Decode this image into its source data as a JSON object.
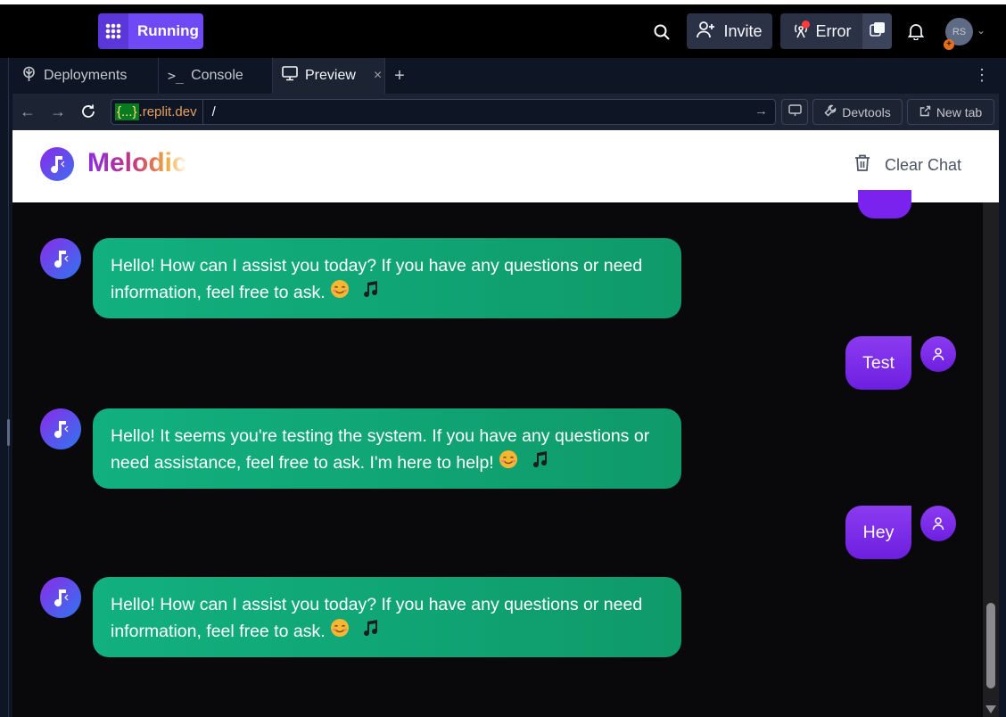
{
  "topbar": {
    "run_label": "Running",
    "invite_label": "Invite",
    "error_label": "Error",
    "avatar_initials": "RS"
  },
  "tabs": [
    {
      "label": "Deployments",
      "icon": "deployments-icon"
    },
    {
      "label": "Console",
      "icon": "console-icon"
    },
    {
      "label": "Preview",
      "icon": "monitor-icon",
      "active": true
    }
  ],
  "urlbar": {
    "host_highlight": "{...}",
    "host_rest": ".replit.dev",
    "path": "/",
    "devtools_label": "Devtools",
    "newtab_label": "New tab"
  },
  "app": {
    "brand": "Melodic",
    "clear_chat_label": "Clear Chat",
    "messages": [
      {
        "role": "bot",
        "text": "Hello! How can I assist you today? If you have any questions or need information, feel free to ask."
      },
      {
        "role": "user",
        "text": "Test"
      },
      {
        "role": "bot",
        "text": "Hello! It seems you're testing the system. If you have any questions or need assistance, feel free to ask. I'm here to help!"
      },
      {
        "role": "user",
        "text": "Hey"
      },
      {
        "role": "bot",
        "text": "Hello! How can I assist you today? If you have any questions or need information, feel free to ask."
      }
    ]
  },
  "colors": {
    "accent": "#6e49f5",
    "bot_bubble": "#12b07f",
    "user_bubble": "#7a22ee"
  }
}
